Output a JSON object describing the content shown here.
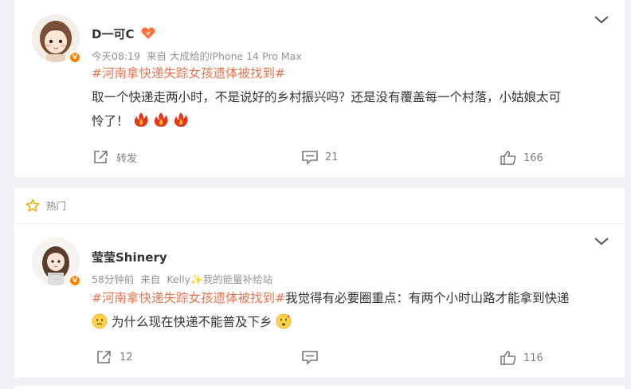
{
  "posts": [
    {
      "username": "D一可C",
      "time": "今天08:19",
      "source_prefix": "来自",
      "source": "大成给的iPhone 14 Pro Max",
      "hashtag": "#河南拿快递失踪女孩遗体被找到#",
      "text_line1": "取一个快递走两小时，不是说好的乡村振兴吗？还是没有覆盖每一个村落，小姑娘太可",
      "text_line2": "怜了！",
      "actions": {
        "share_label": "转发",
        "comment_count": "21",
        "like_count": "166"
      }
    },
    {
      "section_label": "热门",
      "username": "莹莹Shinery",
      "time": "58分钟前",
      "source_prefix": "来自",
      "source": "Kelly✨我的能量补给站",
      "hashtag": "#河南拿快递失踪女孩遗体被找到#",
      "text_line1_after_tag": "我觉得有必要圈重点：有两个小时山路才能拿到快递",
      "text_line2": "为什么现在快递不能普及下乡",
      "actions": {
        "share_count": "12",
        "comment_count": "",
        "like_count": "116"
      }
    }
  ],
  "colors": {
    "hashtag": "#eb7350",
    "verified_badge": "#ff8200",
    "muted": "#939393",
    "background": "#f1f2f5"
  },
  "icons": [
    "vip-heart-icon",
    "verified-icon",
    "chevron-down-icon",
    "share-icon",
    "comment-icon",
    "like-icon",
    "fire-emoji",
    "hot-star-icon",
    "worried-emoji",
    "thinking-emoji"
  ]
}
